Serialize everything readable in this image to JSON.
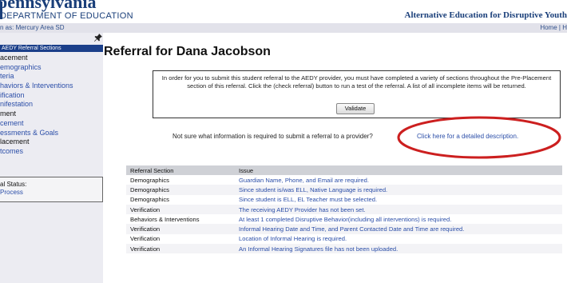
{
  "header": {
    "logo_text": "pennsylvania",
    "department": "DEPARTMENT OF EDUCATION",
    "app_title": "Alternative Education for Disruptive Youth"
  },
  "subbar": {
    "acting_as": "n as:  Mercury Area SD",
    "home_link": "Home",
    "help_link": "H"
  },
  "sidebar": {
    "items": [
      {
        "label": "AEDY Referral Sections",
        "style": "active"
      },
      {
        "label": "acement",
        "style": "black"
      },
      {
        "label": "emographics",
        "style": "link"
      },
      {
        "label": "teria",
        "style": "link"
      },
      {
        "label": "haviors & Interventions",
        "style": "link"
      },
      {
        "label": "ification",
        "style": "link"
      },
      {
        "label": "nifestation",
        "style": "link"
      },
      {
        "label": "ment",
        "style": "black"
      },
      {
        "label": "cement",
        "style": "link"
      },
      {
        "label": "essments & Goals",
        "style": "link"
      },
      {
        "label": "lacement",
        "style": "black"
      },
      {
        "label": "tcomes",
        "style": "link"
      }
    ],
    "status_label": "al Status:",
    "status_value": "Process"
  },
  "main": {
    "title": "Referral for Dana Jacobson",
    "info_text": "In order for you to submit this student referral to the AEDY provider, you must have completed a variety of sections throughout the Pre-Placement section of this referral. Click the (check referral) button to run a test of the referral. A list of all incomplete items will be returned.",
    "validate_label": "Validate",
    "not_sure_text": "Not sure what information is required to submit a referral to a provider?",
    "detail_link": "Click here for a detailed description.",
    "table": {
      "headers": [
        "Referral Section",
        "Issue"
      ],
      "rows": [
        [
          "Demographics",
          "Guardian Name, Phone, and Email are required."
        ],
        [
          "Demographics",
          "Since student is/was ELL, Native Language is required."
        ],
        [
          "Demographics",
          "Since student is ELL, EL Teacher must be selected."
        ],
        [
          "Verification",
          "The receiving AEDY Provider has not been set."
        ],
        [
          "Behaviors & Interventions",
          "At least 1 completed Disruptive Behavior(including all interventions) is required."
        ],
        [
          "Verification",
          "Informal Hearing Date and Time, and Parent Contacted Date and Time are required."
        ],
        [
          "Verification",
          "Location of Informal Hearing is required."
        ],
        [
          "Verification",
          "An Informal Hearing Signatures file has not been uploaded."
        ]
      ]
    }
  },
  "colors": {
    "brand_navy": "#1a3f7a",
    "link_blue": "#2b4ea8",
    "annotation_red": "#cc1f1f"
  }
}
